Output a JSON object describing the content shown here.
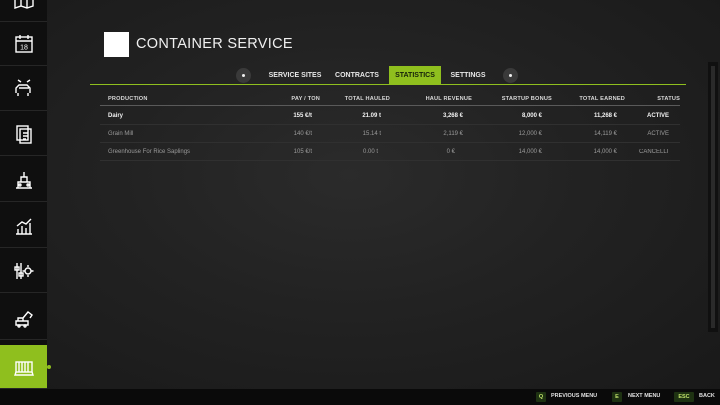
{
  "header": {
    "title": "CONTAINER SERVICE"
  },
  "tabs": [
    {
      "label": "SERVICE SITES"
    },
    {
      "label": "CONTRACTS"
    },
    {
      "label": "STATISTICS"
    },
    {
      "label": "SETTINGS"
    }
  ],
  "table": {
    "columns": [
      "PRODUCTION",
      "PAY / TON",
      "TOTAL HAULED",
      "HAUL REVENUE",
      "STARTUP BONUS",
      "TOTAL EARNED",
      "STATUS"
    ],
    "rows": [
      [
        "Dairy",
        "155 €/t",
        "21.09 t",
        "3,268 €",
        "8,000 €",
        "11,268 €",
        "ACTIVE"
      ],
      [
        "Grain Mill",
        "140 €/t",
        "15.14 t",
        "2,119 €",
        "12,000 €",
        "14,119 €",
        "ACTIVE"
      ],
      [
        "Greenhouse For Rice Saplings",
        "105 €/t",
        "0.00 t",
        "0 €",
        "14,000 €",
        "14,000 €",
        "CANCELLI"
      ]
    ]
  },
  "sidebar": {
    "items": [
      {
        "icon": "map-icon"
      },
      {
        "icon": "calendar-icon"
      },
      {
        "icon": "animals-icon"
      },
      {
        "icon": "contracts-icon"
      },
      {
        "icon": "production-icon"
      },
      {
        "icon": "statistics-icon"
      },
      {
        "icon": "settings-icon"
      },
      {
        "icon": "construction-icon"
      },
      {
        "icon": "container-icon"
      }
    ],
    "calendar_day": "18"
  },
  "footer": {
    "hints": [
      {
        "key": "Q",
        "label": "PREVIOUS MENU"
      },
      {
        "key": "E",
        "label": "NEXT MENU"
      },
      {
        "key": "ESC",
        "label": "BACK"
      }
    ]
  },
  "colors": {
    "accent": "#8fbf1e",
    "background": "#1c1c1c",
    "sidebar": "#0f0f0f"
  }
}
